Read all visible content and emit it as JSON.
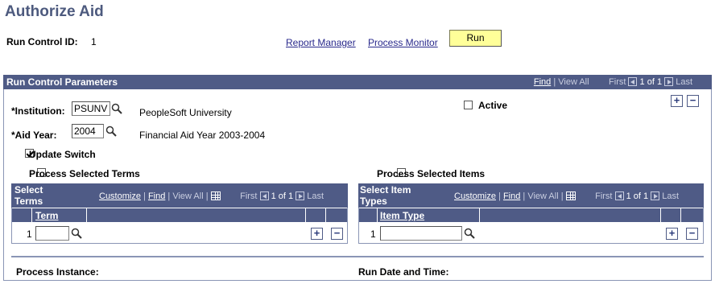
{
  "page": {
    "title": "Authorize Aid"
  },
  "header": {
    "run_control_label": "Run Control ID:",
    "run_control_value": "1",
    "report_manager": "Report Manager",
    "process_monitor": "Process Monitor",
    "run_button": "Run"
  },
  "panel": {
    "title": "Run Control Parameters",
    "nav": {
      "find": "Find",
      "sep": "|",
      "view_all": "View All",
      "first": "First",
      "count": "1 of 1",
      "last": "Last"
    }
  },
  "fields": {
    "institution_label": "*Institution:",
    "institution_value": "PSUNV",
    "institution_desc": "PeopleSoft University",
    "aid_year_label": "*Aid Year:",
    "aid_year_value": "2004",
    "aid_year_desc": "Financial Aid Year 2003-2004",
    "active_label": "Active",
    "active_checked": false,
    "update_switch_label": "Update Switch",
    "update_switch_checked": true,
    "process_terms_label": "Process Selected Terms",
    "process_items_label": "Process Selected Items"
  },
  "terms_grid": {
    "title_line1": "Select",
    "title_line2": "Terms",
    "customize": "Customize",
    "find": "Find",
    "view_all": "View All",
    "sep": "|",
    "first": "First",
    "count": "1 of 1",
    "last": "Last",
    "column": "Term",
    "rows": [
      {
        "num": "1",
        "value": ""
      }
    ]
  },
  "items_grid": {
    "title_line1": "Select Item",
    "title_line2": "Types",
    "customize": "Customize",
    "find": "Find",
    "view_all": "View All",
    "sep": "|",
    "first": "First",
    "count": "1 of 1",
    "last": "Last",
    "column": "Item Type",
    "rows": [
      {
        "num": "1",
        "value": ""
      }
    ]
  },
  "footer": {
    "process_instance_label": "Process Instance:",
    "run_date_label": "Run Date and Time:"
  },
  "icons": {
    "add": "+",
    "delete": "−"
  }
}
